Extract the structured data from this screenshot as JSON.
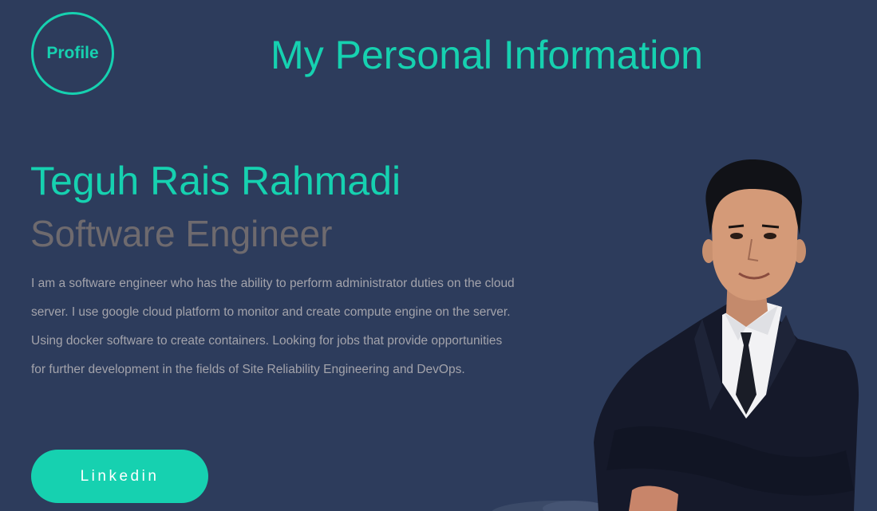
{
  "header": {
    "badge_label": "Profile",
    "title": "My Personal Information"
  },
  "hero": {
    "name": "Teguh Rais Rahmadi",
    "role": "Software Engineer",
    "bio": "I am a software engineer who has the ability to perform administrator duties on the cloud server. I use google cloud platform to monitor and create compute engine on the server. Using docker software to create containers. Looking for jobs that provide opportunities for further development in the fields of Site Reliability Engineering and DevOps.",
    "cta_label": "Linkedin"
  },
  "colors": {
    "background": "#2d3c5c",
    "accent": "#16d1b0",
    "role_text": "#6e6a6e",
    "body_text": "#a3a3ab"
  }
}
